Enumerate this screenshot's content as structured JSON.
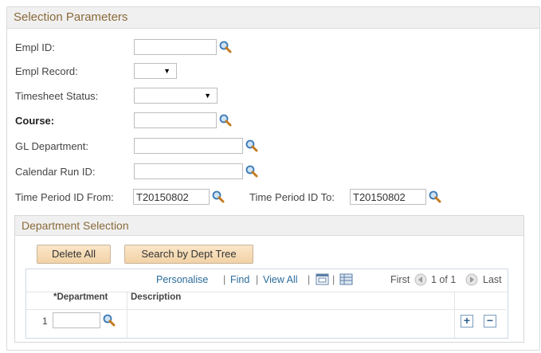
{
  "panel": {
    "title": "Selection Parameters"
  },
  "fields": {
    "empl_id": {
      "label": "Empl ID:",
      "value": ""
    },
    "empl_record": {
      "label": "Empl Record:",
      "value": ""
    },
    "timesheet_status": {
      "label": "Timesheet Status:",
      "value": ""
    },
    "course": {
      "label": "Course:",
      "value": ""
    },
    "gl_department": {
      "label": "GL Department:",
      "value": ""
    },
    "calendar_run_id": {
      "label": "Calendar Run ID:",
      "value": ""
    },
    "time_period_from": {
      "label": "Time Period ID From:",
      "value": "T20150802"
    },
    "time_period_to": {
      "label": "Time Period ID To:",
      "value": "T20150802"
    }
  },
  "department_selection": {
    "title": "Department Selection",
    "buttons": {
      "delete_all": "Delete All",
      "search_dept_tree": "Search by Dept Tree"
    },
    "grid": {
      "nav": {
        "personalise": "Personalise",
        "find": "Find",
        "view_all": "View All",
        "sep": "|",
        "first": "First",
        "count": "1 of 1",
        "last": "Last"
      },
      "columns": [
        "*Department",
        "Description"
      ],
      "rows": [
        {
          "num": "1",
          "department": "",
          "description": ""
        }
      ]
    }
  },
  "icons": [
    "magnifier-icon",
    "dropdown-arrow-icon",
    "first-arrow-icon",
    "last-arrow-icon",
    "zoom-grid-icon",
    "download-grid-icon",
    "add-row-icon",
    "delete-row-icon"
  ],
  "colors": {
    "header_text": "#8a6a3a",
    "button_bg": "#f2d2a6",
    "link": "#2b6b9a"
  }
}
